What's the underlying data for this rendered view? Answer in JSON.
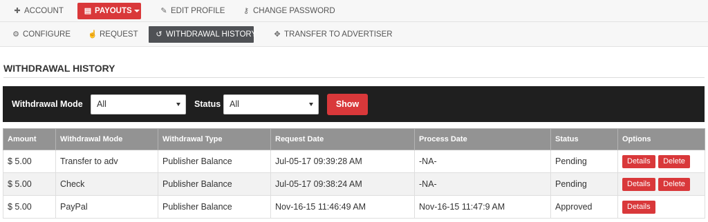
{
  "topnav": {
    "items": [
      {
        "label": "ACCOUNT",
        "icon": "user-plus-icon"
      },
      {
        "label": "PAYOUTS",
        "icon": "credit-card-icon"
      },
      {
        "label": "EDIT PROFILE",
        "icon": "edit-icon"
      },
      {
        "label": "CHANGE PASSWORD",
        "icon": "key-icon"
      }
    ]
  },
  "subnav": {
    "items": [
      {
        "label": "CONFIGURE",
        "icon": "gear-icon"
      },
      {
        "label": "REQUEST",
        "icon": "hand-pointer-icon"
      },
      {
        "label": "WITHDRAWAL HISTORY",
        "icon": "history-icon"
      },
      {
        "label": "TRANSFER TO ADVERTISER",
        "icon": "arrows-icon"
      }
    ]
  },
  "page": {
    "title": "WITHDRAWAL HISTORY"
  },
  "filters": {
    "mode_label": "Withdrawal Mode",
    "mode_value": "All",
    "status_label": "Status",
    "status_value": "All",
    "show_label": "Show"
  },
  "table": {
    "headers": [
      "Amount",
      "Withdrawal Mode",
      "Withdrawal Type",
      "Request Date",
      "Process Date",
      "Status",
      "Options"
    ],
    "rows": [
      {
        "amount": "$ 5.00",
        "mode": "Transfer to adv",
        "type": "Publisher Balance",
        "request_date": "Jul-05-17 09:39:28 AM",
        "process_date": "-NA-",
        "status": "Pending",
        "details": "Details",
        "delete": "Delete"
      },
      {
        "amount": "$ 5.00",
        "mode": "Check",
        "type": "Publisher Balance",
        "request_date": "Jul-05-17 09:38:24 AM",
        "process_date": "-NA-",
        "status": "Pending",
        "details": "Details",
        "delete": "Delete"
      },
      {
        "amount": "$ 5.00",
        "mode": "PayPal",
        "type": "Publisher Balance",
        "request_date": "Nov-16-15 11:46:49 AM",
        "process_date": "Nov-16-15 11:47:9 AM",
        "status": "Approved",
        "details": "Details"
      }
    ]
  },
  "colors": {
    "accent": "#d9383a",
    "header_gray": "#939393",
    "filter_bar": "#1f1f1f",
    "active_tab": "#4f5155"
  }
}
